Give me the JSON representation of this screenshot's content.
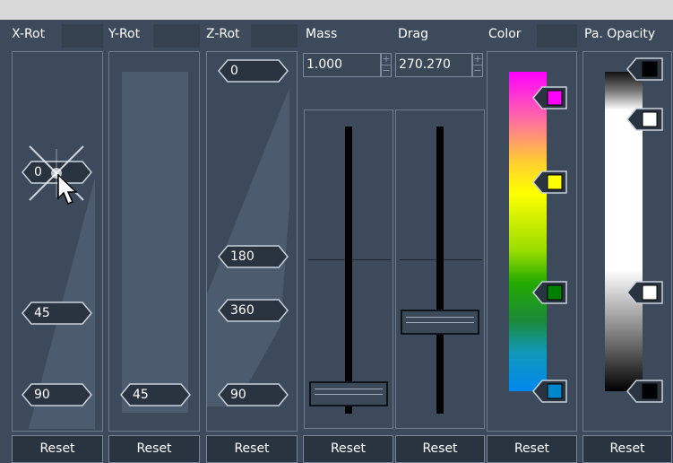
{
  "panels": {
    "xrot": {
      "header": "X-Rot",
      "markers": [
        "0",
        "45",
        "90"
      ],
      "reset": "Reset"
    },
    "yrot": {
      "header": "Y-Rot",
      "markers": [
        "45"
      ],
      "reset": "Reset"
    },
    "zrot": {
      "header": "Z-Rot",
      "markers": [
        "0",
        "180",
        "360",
        "90"
      ],
      "reset": "Reset"
    },
    "mass": {
      "header": "Mass",
      "value": "1.000",
      "spin_up": "+",
      "spin_down": "−",
      "level": 0.0,
      "reset": "Reset"
    },
    "drag": {
      "header": "Drag",
      "value": "270.270",
      "spin_up": "+",
      "spin_down": "−",
      "level": 0.27,
      "reset": "Reset"
    },
    "color": {
      "header": "Color",
      "swatches": [
        "#ff00ff",
        "#ffff00",
        "#008000",
        "#0088cc"
      ],
      "reset": "Reset"
    },
    "opacity": {
      "header": "Pa. Opacity",
      "swatches": [
        "#000000",
        "#ffffff",
        "#ffffff",
        "#000000"
      ],
      "reset": "Reset"
    }
  },
  "colors": {
    "background": "#3d4a5c",
    "header_field": "#35414f",
    "button": "#2a3440",
    "border": "#6f7c8e"
  },
  "icons": {
    "cursor": "arrow-cursor-icon",
    "highlight": "sparkle-highlight-icon"
  }
}
